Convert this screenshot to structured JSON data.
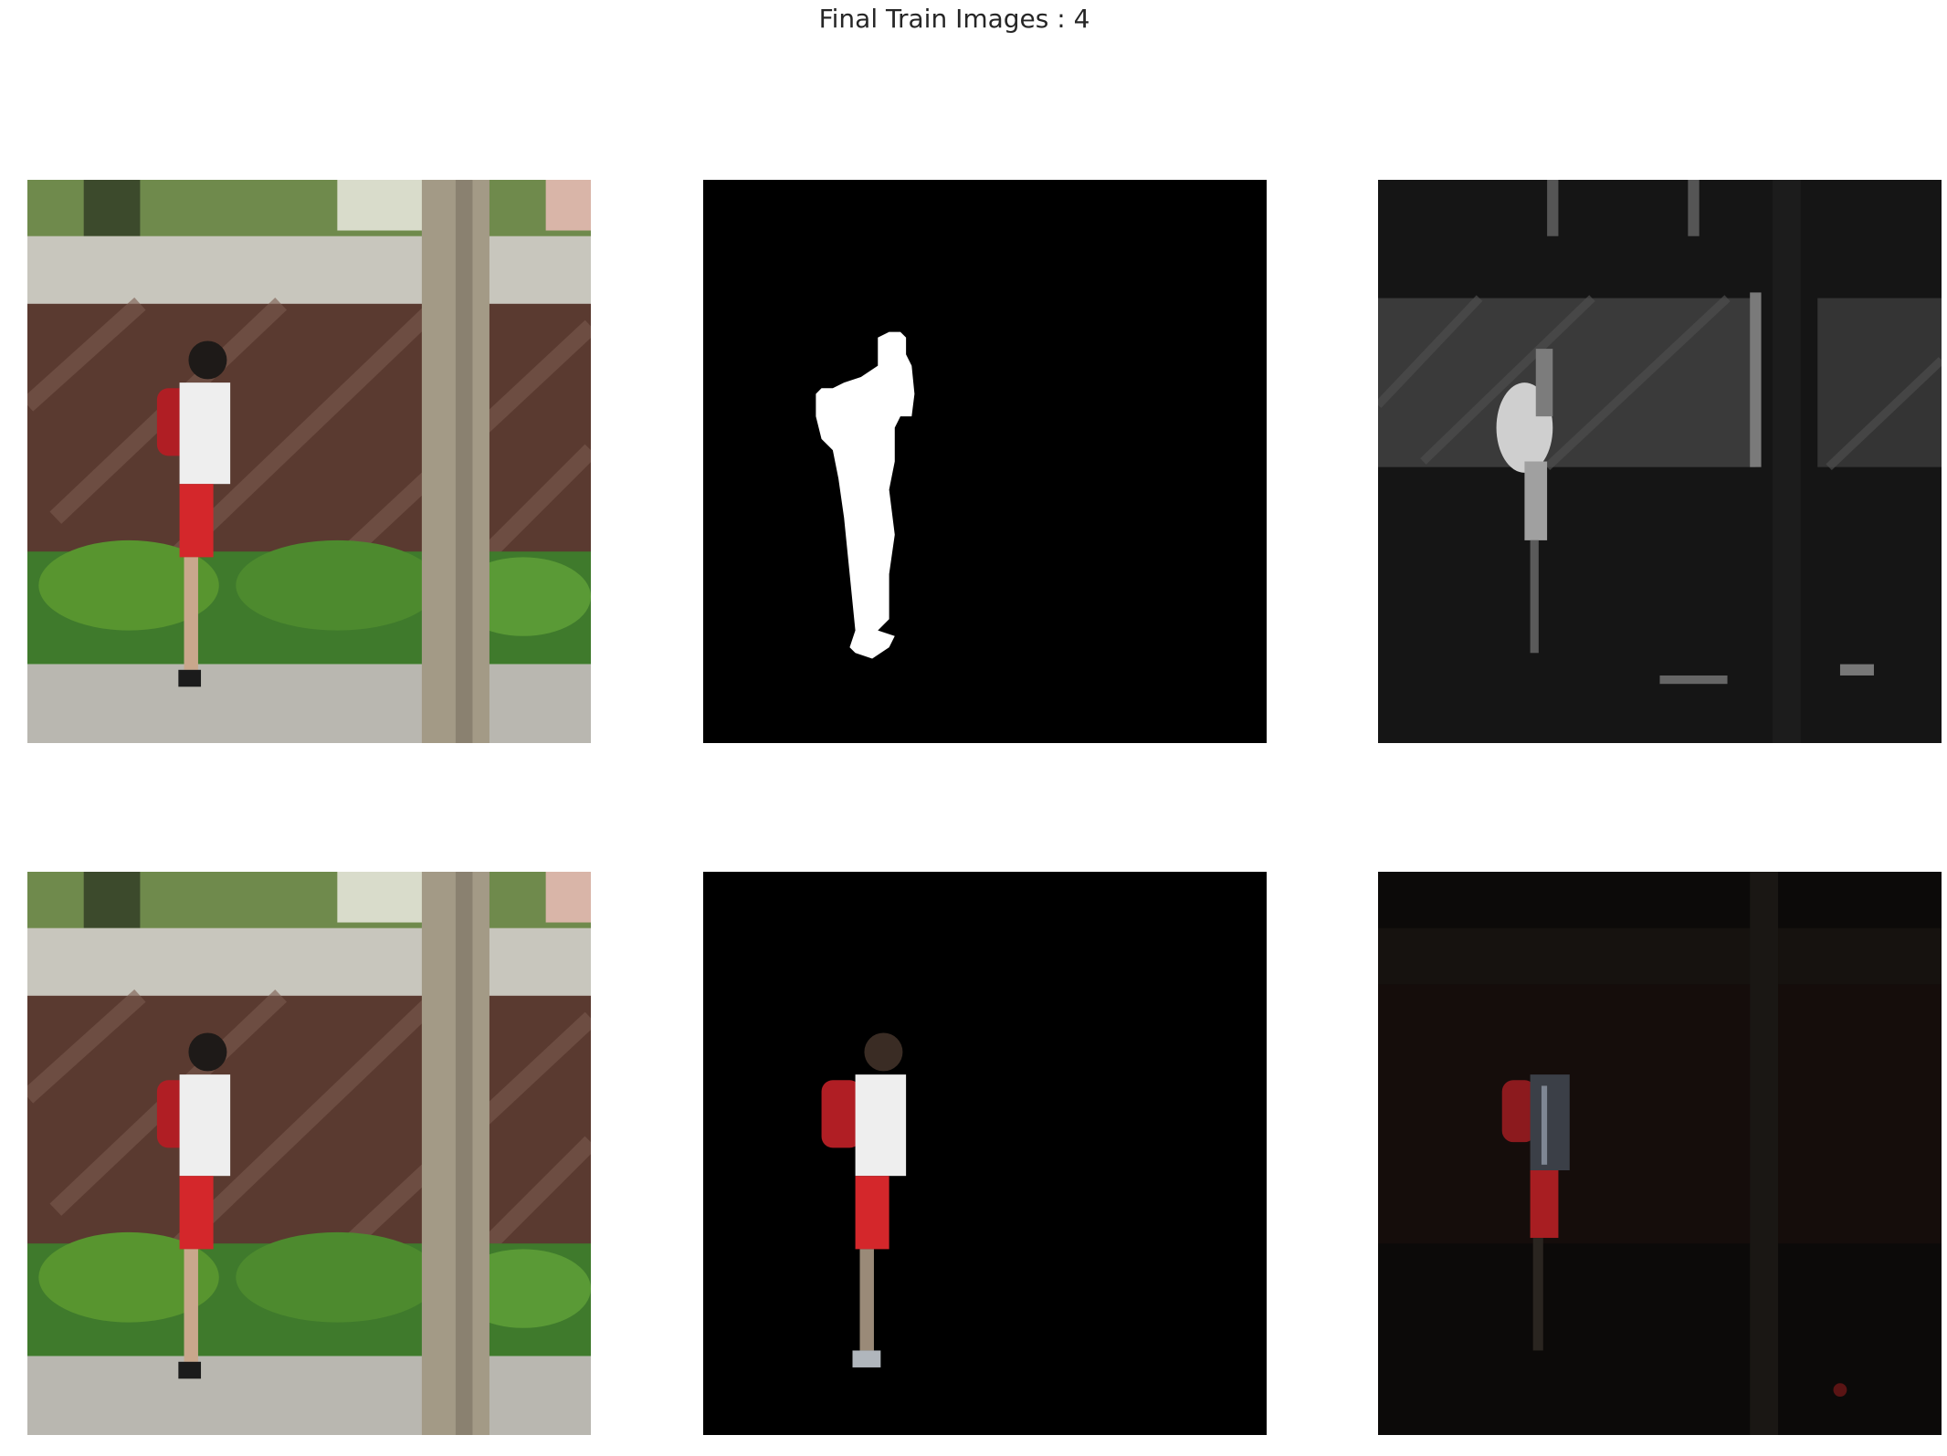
{
  "figure": {
    "title": "Final Train Images : 4"
  },
  "panels": [
    {
      "row": 1,
      "col": 1,
      "content": "original-photo"
    },
    {
      "row": 1,
      "col": 2,
      "content": "binary-mask"
    },
    {
      "row": 1,
      "col": 3,
      "content": "grayscale-prediction"
    },
    {
      "row": 2,
      "col": 1,
      "content": "original-photo"
    },
    {
      "row": 2,
      "col": 2,
      "content": "masked-photo"
    },
    {
      "row": 2,
      "col": 3,
      "content": "predicted-masked-photo"
    }
  ],
  "colors": {
    "background": "#ffffff",
    "title": "#262626",
    "mask_bg": "#000000",
    "mask_fg": "#ffffff",
    "brick": "#5a3a30",
    "wall_top": "#c8c6bd",
    "foliage": "#3f7a2c",
    "trunk": "#a39a86",
    "backpack": "#b01e24",
    "shorts": "#d4272b",
    "shirt": "#eeeeee"
  }
}
